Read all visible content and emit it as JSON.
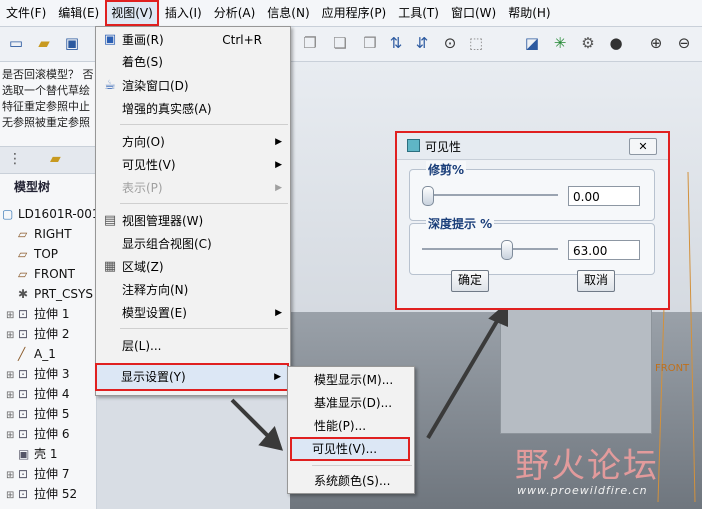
{
  "menubar": {
    "items": [
      "文件(F)",
      "编辑(E)",
      "视图(V)",
      "插入(I)",
      "分析(A)",
      "信息(N)",
      "应用程序(P)",
      "工具(T)",
      "窗口(W)",
      "帮助(H)"
    ]
  },
  "left_messages": [
    "是否回滚模型？ 否",
    "选取一个替代草绘",
    "特征重定参照中止",
    "无参照被重定参照"
  ],
  "model_tree": {
    "title": "模型树",
    "items": [
      "LD1601R-001",
      "RIGHT",
      "TOP",
      "FRONT",
      "PRT_CSYS",
      "拉伸 1",
      "拉伸 2",
      "A_1",
      "拉伸 3",
      "拉伸 4",
      "拉伸 5",
      "拉伸 6",
      "壳 1",
      "拉伸 7",
      "拉伸 52"
    ]
  },
  "view_menu": {
    "items": [
      {
        "label": "重画(R)",
        "shortcut": "Ctrl+R",
        "icon": "redraw-icon"
      },
      {
        "label": "着色(S)"
      },
      {
        "label": "渲染窗口(D)",
        "icon": "render-icon"
      },
      {
        "label": "增强的真实感(A)"
      },
      {
        "label": "方向(O)"
      },
      {
        "label": "可见性(V)"
      },
      {
        "label": "表示(P)"
      },
      {
        "label": "视图管理器(W)",
        "icon": "view-manager-icon"
      },
      {
        "label": "显示组合视图(C)"
      },
      {
        "label": "区域(Z)",
        "icon": "region-icon"
      },
      {
        "label": "注释方向(N)"
      },
      {
        "label": "模型设置(E)"
      },
      {
        "label": "层(L)..."
      },
      {
        "label": "显示设置(Y)"
      }
    ]
  },
  "display_submenu": {
    "items": [
      "模型显示(M)...",
      "基准显示(D)...",
      "性能(P)...",
      "可见性(V)...",
      "系统颜色(S)..."
    ]
  },
  "visibility_dialog": {
    "title": "可见性",
    "trim_label": "修剪%",
    "trim_value": "0.00",
    "trim_fraction": 0.0,
    "depth_label": "深度提示 %",
    "depth_value": "63.00",
    "depth_fraction": 0.63,
    "ok_label": "确定",
    "cancel_label": "取消"
  },
  "viewport": {
    "front_label": "FRONT"
  },
  "watermark": {
    "text": "野火论坛",
    "url": "www.proewildfire.cn"
  },
  "colors": {
    "highlight": "#e02020"
  }
}
